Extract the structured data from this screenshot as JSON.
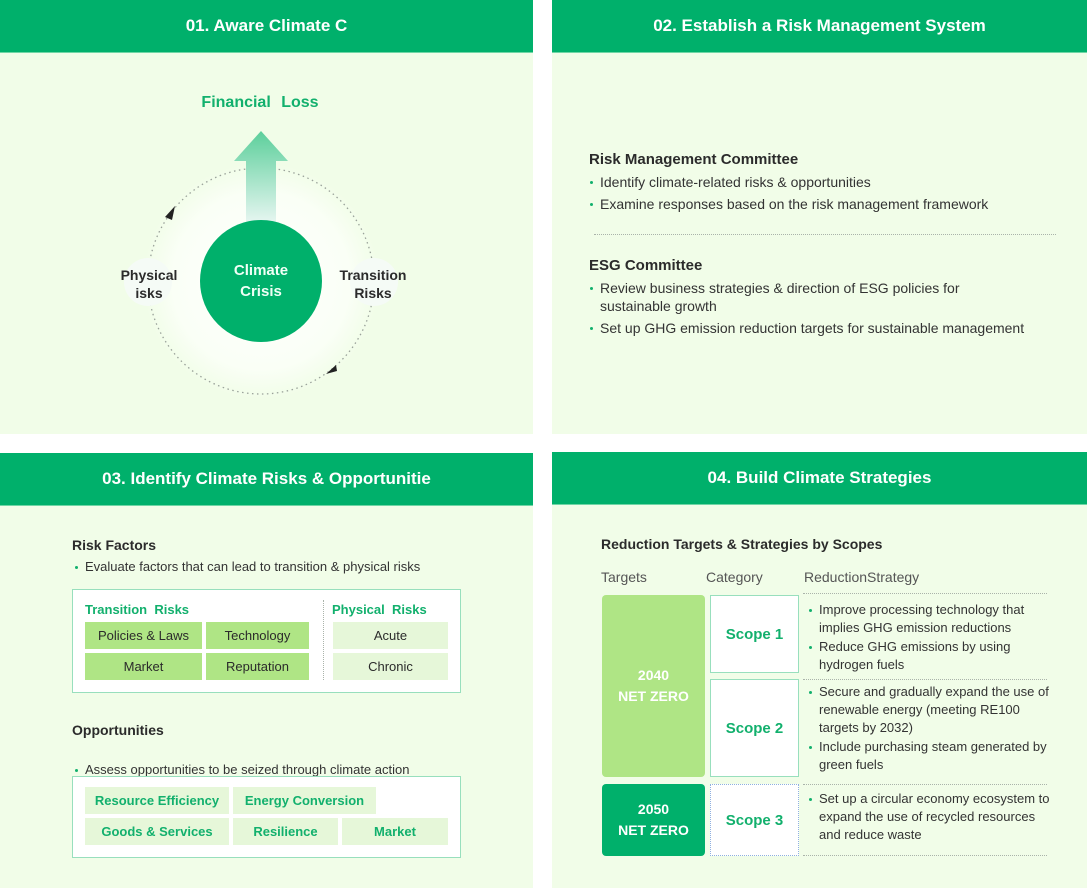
{
  "colors": {
    "brand_green": "#00b06b",
    "panel_bg": "#f1fde8",
    "light_green": "#afe585",
    "pale_green": "#e6f7d9"
  },
  "panel1": {
    "title": "01. Aware Climate C",
    "financial_loss": "Financial Loss",
    "center_line1": "Climate",
    "center_line2": "Crisis",
    "left_line1": "Physical",
    "left_line2": "isks",
    "right_line1": "Transition",
    "right_line2": "Risks",
    "icons": [
      "up-arrow-icon",
      "cycle-arrow-icon"
    ]
  },
  "panel2": {
    "title": "02. Establish a Risk Management System",
    "sections": [
      {
        "heading": "Risk Management Committee",
        "bullets": [
          "Identify climate-related risks &  opportunities",
          "Examine responses based on the risk management framework"
        ]
      },
      {
        "heading": "ESG Committee",
        "bullets": [
          "Review business strategies & direction of ESG policies for sustainable growth",
          "Set up GHG emission reduction targets for sustainable management"
        ]
      }
    ]
  },
  "panel3": {
    "title": "03. Identify Climate Risks & Opportunitie",
    "risk_heading": "Risk Factors",
    "risk_bullet": "Evaluate factors that can lead to transition & physical risks",
    "transition_label": "Transition  Risks",
    "transition_items": [
      "Policies & Laws",
      "Technology",
      "Market",
      "Reputation"
    ],
    "physical_label": "Physical  Risks",
    "physical_items": [
      "Acute",
      "Chronic"
    ],
    "opp_heading": "Opportunities",
    "opp_bullet": "Assess opportunities to be seized through climate action",
    "opp_items": [
      "Resource Efficiency",
      "Energy Conversion",
      "Goods & Services",
      "Resilience",
      "Market"
    ]
  },
  "panel4": {
    "title": "04. Build Climate Strategies",
    "subtitle": "Reduction Targets & Strategies by Scopes",
    "col_targets": "Targets",
    "col_category": "Category",
    "col_strategy": "ReductionStrategy",
    "target_2040_year": "2040",
    "target_2040_label": "NET ZERO",
    "target_2050_year": "2050",
    "target_2050_label": "NET ZERO",
    "scopes": [
      {
        "name": "Scope 1",
        "strategies": [
          "Improve processing technology that implies GHG emission reductions",
          "Reduce GHG emissions by using hydrogen fuels"
        ]
      },
      {
        "name": "Scope 2",
        "strategies": [
          "Secure and gradually expand the use of renewable energy (meeting RE100 targets by 2032)",
          "Include purchasing steam generated by green fuels"
        ]
      },
      {
        "name": "Scope 3",
        "strategies": [
          "Set up a circular economy ecosystem to expand the use of recycled resources and reduce waste"
        ]
      }
    ]
  }
}
